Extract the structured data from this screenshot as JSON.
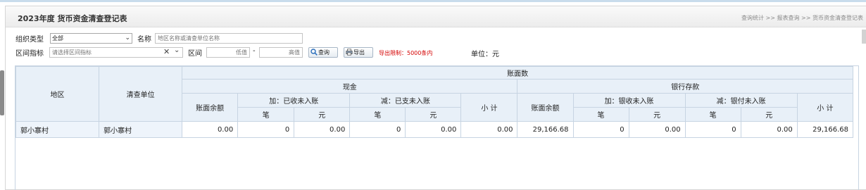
{
  "header": {
    "title": "2023年度 货币资金清查登记表",
    "breadcrumb": "查询统计 >> 报表查询 >> 货币资金清查登记表"
  },
  "filters": {
    "org_type_label": "组织类型",
    "org_type_value": "全部",
    "name_label": "名称",
    "name_placeholder": "地区名称或清查单位名称",
    "interval_indicator_label": "区间指标",
    "interval_indicator_placeholder": "请选择区间指标",
    "interval_label": "区间",
    "low_placeholder": "低值",
    "separator": "-",
    "high_placeholder": "高值",
    "query_button": "查询",
    "export_button": "导出",
    "export_limit": "导出限制：5000条内",
    "unit": "单位：元"
  },
  "table": {
    "top_group": "账面数",
    "col_region": "地区",
    "col_unit": "清查单位",
    "cash": {
      "label": "现金",
      "balance": "账面余额",
      "add_label": "加：已收未入账",
      "sub_label": "减：已支未入账",
      "subtotal": "小 计"
    },
    "bank": {
      "label": "银行存款",
      "balance": "账面余额",
      "add_label": "加：银收未入账",
      "sub_label": "减：银付未入账",
      "subtotal": "小 计"
    },
    "count_label": "笔",
    "amount_label": "元",
    "rows": [
      {
        "region": "郭小寨村",
        "unit": "郭小寨村",
        "cash_balance": "0.00",
        "cash_add_count": "0",
        "cash_add_amount": "0.00",
        "cash_sub_count": "0",
        "cash_sub_amount": "0.00",
        "cash_subtotal": "0.00",
        "bank_balance": "29,166.68",
        "bank_add_count": "0",
        "bank_add_amount": "0.00",
        "bank_sub_count": "0",
        "bank_sub_amount": "0.00",
        "bank_subtotal": "29,166.68"
      }
    ]
  }
}
